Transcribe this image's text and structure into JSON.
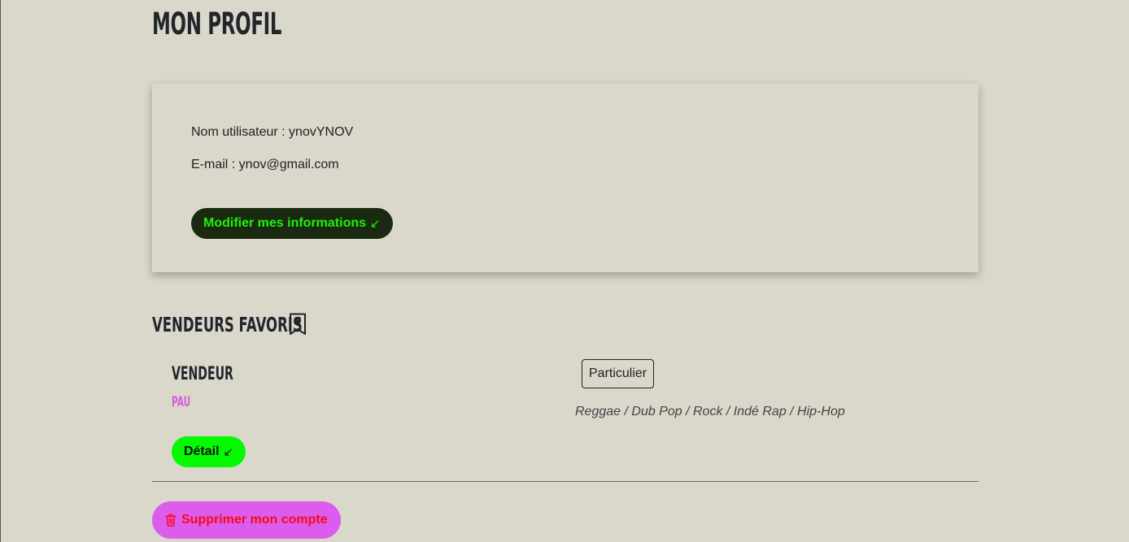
{
  "page": {
    "title": "MON PROFIL"
  },
  "profile": {
    "username_line": "Nom utilisateur : ynovYNOV",
    "email_line": "E-mail : ynov@gmail.com",
    "edit_label": "Modifier mes informations",
    "edit_icon": "↙"
  },
  "favorites": {
    "title": "VENDEURS FAVORIS",
    "title_icon": "bookmark-heart-icon",
    "sellers": [
      {
        "label": "VENDEUR",
        "city": "PAU",
        "type": "Particulier",
        "genres": "Reggae / Dub Pop / Rock / Indé Rap / Hip-Hop",
        "detail_label": "Détail",
        "detail_icon": "↙"
      }
    ]
  },
  "account": {
    "delete_label": "Supprimer mon compte",
    "delete_icon": "trash-icon"
  },
  "colors": {
    "background": "#dad7cb",
    "edit_button_bg": "#1a2a10",
    "edit_button_text": "#1df20b",
    "detail_button_bg": "#05f903",
    "city_accent": "#d35ddf",
    "delete_button_bg": "#dc5cee",
    "delete_button_text": "#f70a14"
  }
}
